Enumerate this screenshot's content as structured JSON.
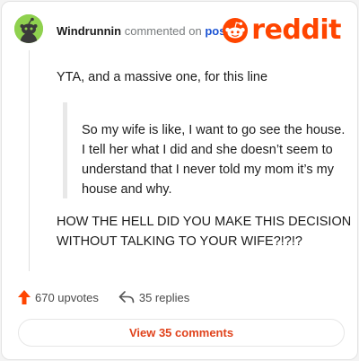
{
  "header": {
    "username": "Windrunnin",
    "action_text": "commented on",
    "post_link": "post"
  },
  "logo": {
    "wordmark": "reddit",
    "icon": "reddit-snoo-icon",
    "color": "#ff4500"
  },
  "avatar": {
    "icon": "snoo-avatar-icon",
    "background": "#8fd14f"
  },
  "comment": {
    "intro": "YTA, and a massive one, for this line",
    "quote": "So my wife is like, I want to go see the house. I tell her what I did and she doesn’t seem to understand that I never told my mom it’s my house and why.",
    "conclusion": "HOW THE HELL DID YOU MAKE THIS DECISION WITHOUT TALKING TO YOUR WIFE?!?!?"
  },
  "stats": {
    "upvotes": "670 upvotes",
    "upvote_icon": "upvote-arrow-icon",
    "replies": "35 replies",
    "reply_icon": "reply-arrow-icon"
  },
  "footer": {
    "view_comments_label": "View 35 comments"
  }
}
